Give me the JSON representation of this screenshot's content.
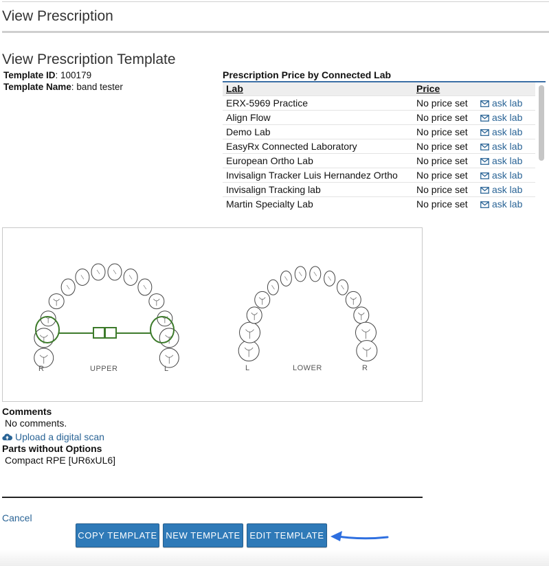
{
  "page": {
    "title": "View Prescription"
  },
  "template": {
    "heading": "View Prescription Template",
    "id_label": "Template ID",
    "id_value": "100179",
    "name_label": "Template Name",
    "name_value": "band tester"
  },
  "price_table": {
    "title": "Prescription Price by Connected Lab",
    "headers": {
      "lab": "Lab",
      "price": "Price"
    },
    "rows": [
      {
        "lab": "ERX-5969 Practice",
        "price": "No price set",
        "action": "ask lab"
      },
      {
        "lab": "Align Flow",
        "price": "No price set",
        "action": "ask lab"
      },
      {
        "lab": "Demo Lab",
        "price": "No price set",
        "action": "ask lab"
      },
      {
        "lab": "EasyRx Connected Laboratory",
        "price": "No price set",
        "action": "ask lab"
      },
      {
        "lab": "European Ortho Lab",
        "price": "No price set",
        "action": "ask lab"
      },
      {
        "lab": "Invisalign Tracker Luis Hernandez Ortho",
        "price": "No price set",
        "action": "ask lab"
      },
      {
        "lab": "Invisalign Tracking lab",
        "price": "No price set",
        "action": "ask lab"
      },
      {
        "lab": "Martin Specialty Lab",
        "price": "No price set",
        "action": "ask lab"
      }
    ]
  },
  "tooth_chart": {
    "upper": {
      "label": "UPPER",
      "left_side": "R",
      "right_side": "L"
    },
    "lower": {
      "label": "LOWER",
      "left_side": "L",
      "right_side": "R"
    },
    "appliance_color": "#3c7a2a"
  },
  "comments": {
    "heading": "Comments",
    "value": "No comments."
  },
  "upload": {
    "label": "Upload a digital scan",
    "icon": "cloud-upload-icon"
  },
  "parts": {
    "heading": "Parts without Options",
    "value": "Compact RPE [UR6xUL6]"
  },
  "actions": {
    "cancel": "Cancel",
    "copy": "COPY TEMPLATE",
    "new": "NEW TEMPLATE",
    "edit": "EDIT TEMPLATE"
  },
  "colors": {
    "link": "#2a6496",
    "button": "#2f7ab8",
    "annotation_arrow": "#2e6fe0"
  }
}
